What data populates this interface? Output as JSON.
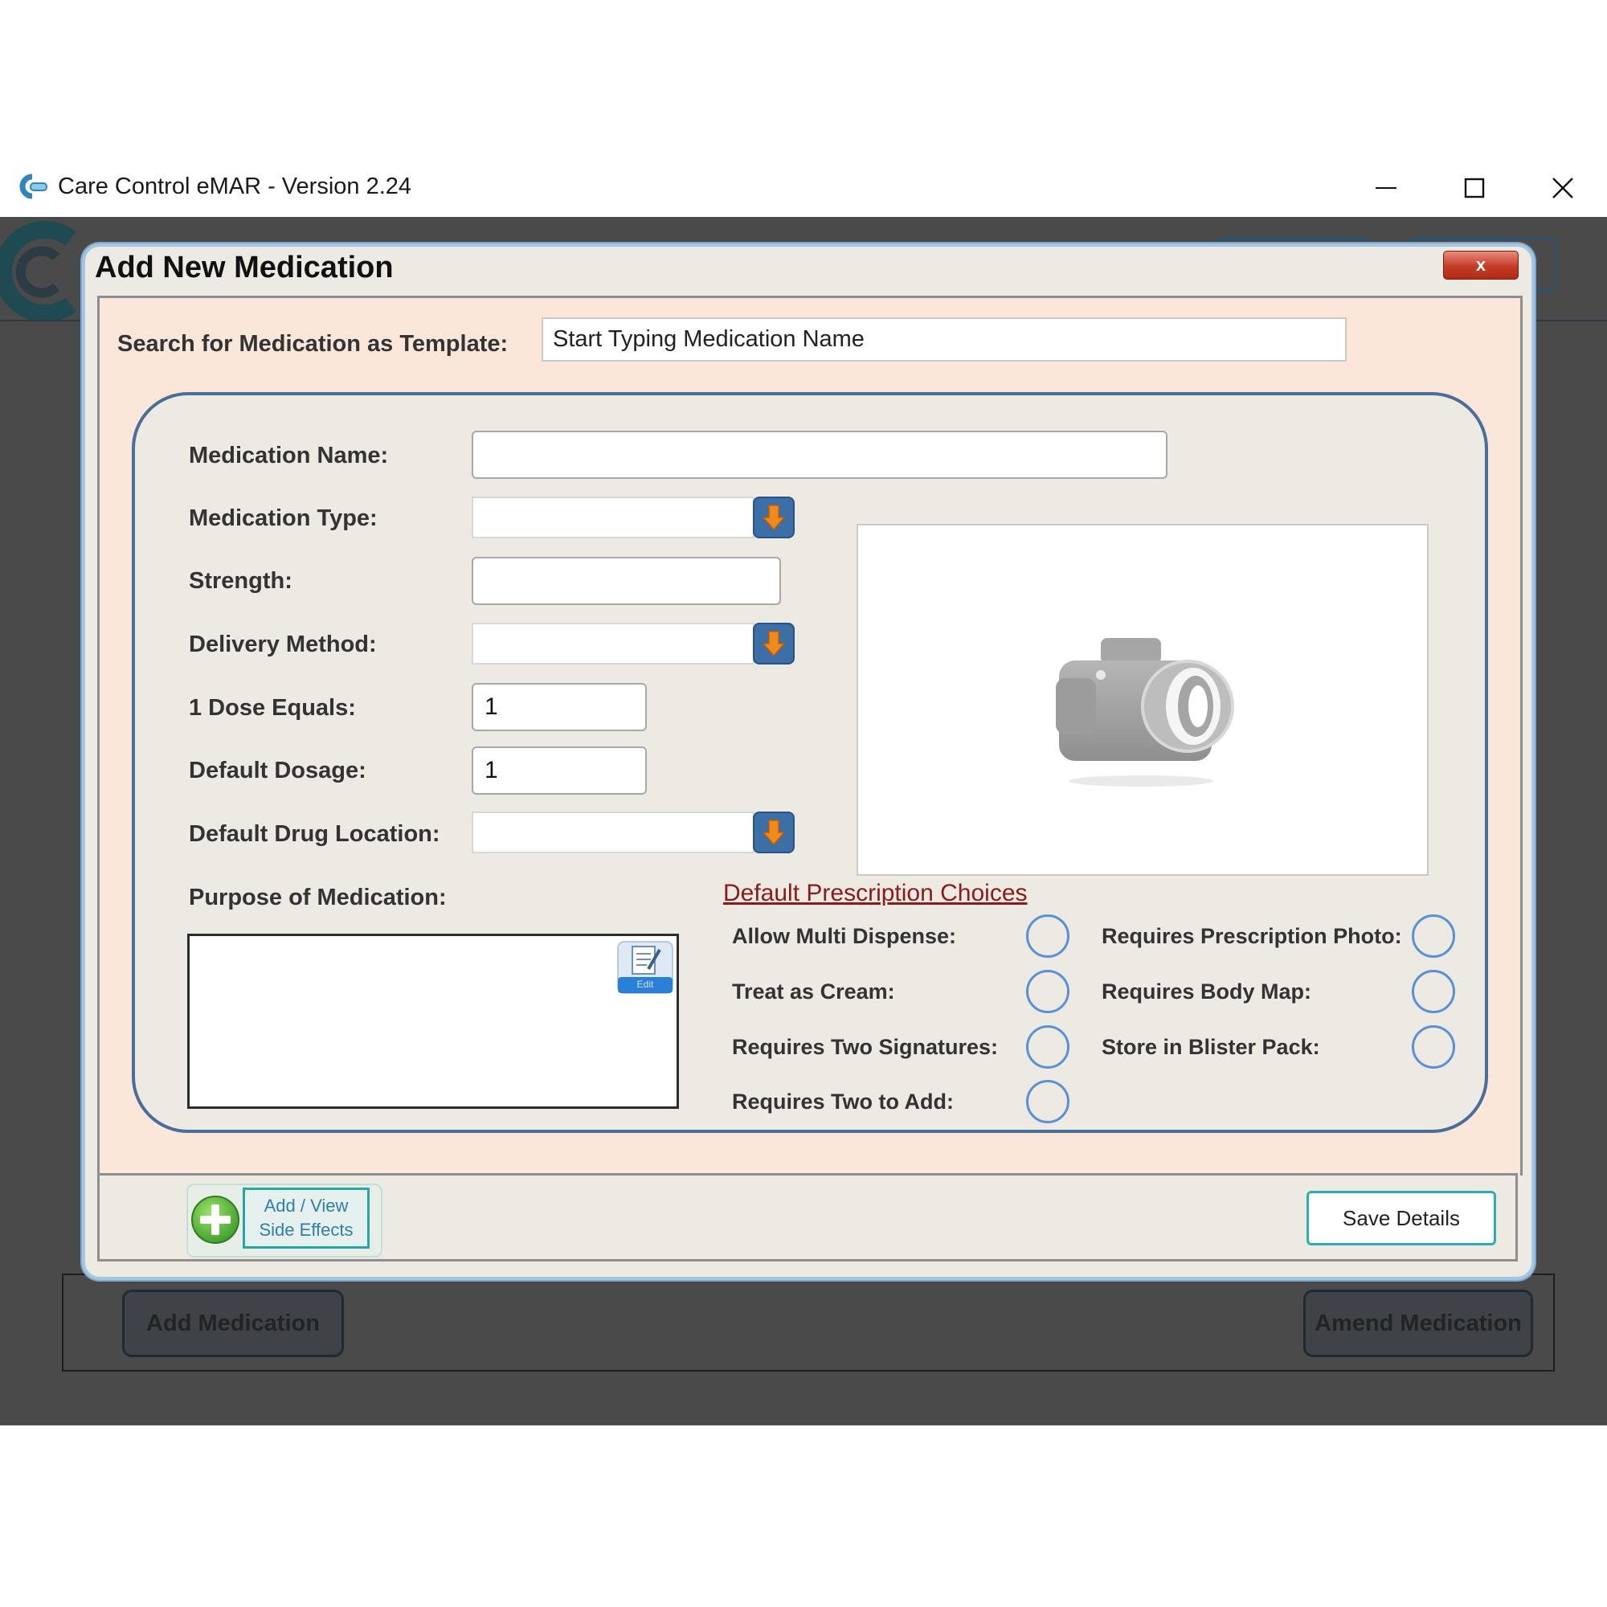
{
  "window": {
    "title": "Care Control eMAR - Version 2.24",
    "controls": {
      "minimize_icon": "minimize-icon",
      "maximize_icon": "maximize-icon",
      "close_icon": "close-icon"
    }
  },
  "background": {
    "add_medication_label": "Add Medication",
    "amend_medication_label": "Amend Medication"
  },
  "dialog": {
    "title": "Add New Medication",
    "close_label": "x",
    "search": {
      "label": "Search for Medication as Template:",
      "value": "Start Typing Medication Name"
    },
    "fields": {
      "medication_name": {
        "label": "Medication Name:",
        "value": ""
      },
      "medication_type": {
        "label": "Medication Type:",
        "value": ""
      },
      "strength": {
        "label": "Strength:",
        "value": ""
      },
      "delivery_method": {
        "label": "Delivery Method:",
        "value": ""
      },
      "dose_equals": {
        "label": "1 Dose Equals:",
        "value": "1"
      },
      "default_dosage": {
        "label": "Default Dosage:",
        "value": "1"
      },
      "default_drug_location": {
        "label": "Default Drug Location:",
        "value": ""
      },
      "purpose": {
        "label": "Purpose of Medication:",
        "value": ""
      }
    },
    "edit_icon_caption": "Edit",
    "prescription_choices": {
      "heading": "Default Prescription Choices",
      "allow_multi_dispense": "Allow Multi Dispense:",
      "treat_as_cream": "Treat as Cream:",
      "requires_two_signatures": "Requires Two Signatures:",
      "requires_two_to_add": "Requires Two to Add:",
      "requires_prescription_photo": "Requires Prescription Photo:",
      "requires_body_map": "Requires Body Map:",
      "store_in_blister_pack": "Store in Blister Pack:"
    },
    "side_effects": {
      "line1": "Add / View",
      "line2": "Side Effects"
    },
    "save_label": "Save Details"
  },
  "colors": {
    "dialog_bg": "#eceae2",
    "form_bg": "#fbe6da",
    "accent_orange": "#f08a1c",
    "combo_button_blue": "#3c6fa6",
    "radio_blue": "#5b8fd6",
    "link_red": "#8b1a1a",
    "teal_border": "#2ab0b3",
    "app_bg": "#4a4a4a"
  }
}
